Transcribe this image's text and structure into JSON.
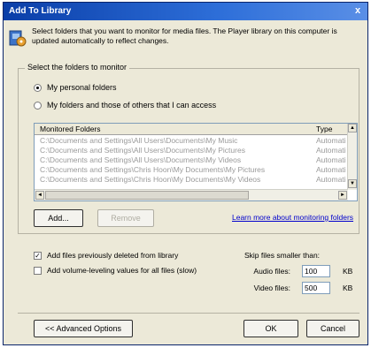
{
  "window": {
    "title": "Add To Library",
    "close_glyph": "x"
  },
  "header": {
    "icon": "media-library-icon",
    "text": "Select folders that you want to monitor for media files. The Player library on this computer is updated automatically to reflect changes."
  },
  "group": {
    "label": "Select the folders to monitor",
    "options": [
      {
        "label": "My personal folders",
        "selected": true
      },
      {
        "label": "My folders and those of others that I can access",
        "selected": false
      }
    ]
  },
  "list": {
    "columns": [
      "Monitored Folders",
      "Type"
    ],
    "rows": [
      {
        "folder": "C:\\Documents and Settings\\All Users\\Documents\\My Music",
        "type": "Automati"
      },
      {
        "folder": "C:\\Documents and Settings\\All Users\\Documents\\My Pictures",
        "type": "Automati"
      },
      {
        "folder": "C:\\Documents and Settings\\All Users\\Documents\\My Videos",
        "type": "Automati"
      },
      {
        "folder": "C:\\Documents and Settings\\Chris Hoon\\My Documents\\My Pictures",
        "type": "Automati"
      },
      {
        "folder": "C:\\Documents and Settings\\Chris Hoon\\My Documents\\My Videos",
        "type": "Automati"
      }
    ]
  },
  "buttons": {
    "add": "Add...",
    "remove": "Remove",
    "advanced": "<< Advanced Options",
    "ok": "OK",
    "cancel": "Cancel"
  },
  "link": "Learn more about monitoring folders",
  "checkboxes": [
    {
      "label": "Add files previously deleted from library",
      "checked": true
    },
    {
      "label": "Add volume-leveling values for all files (slow)",
      "checked": false
    }
  ],
  "skip": {
    "label": "Skip files smaller than:",
    "audio_label": "Audio files:",
    "audio_value": "100",
    "audio_unit": "KB",
    "video_label": "Video files:",
    "video_value": "500",
    "video_unit": "KB"
  }
}
